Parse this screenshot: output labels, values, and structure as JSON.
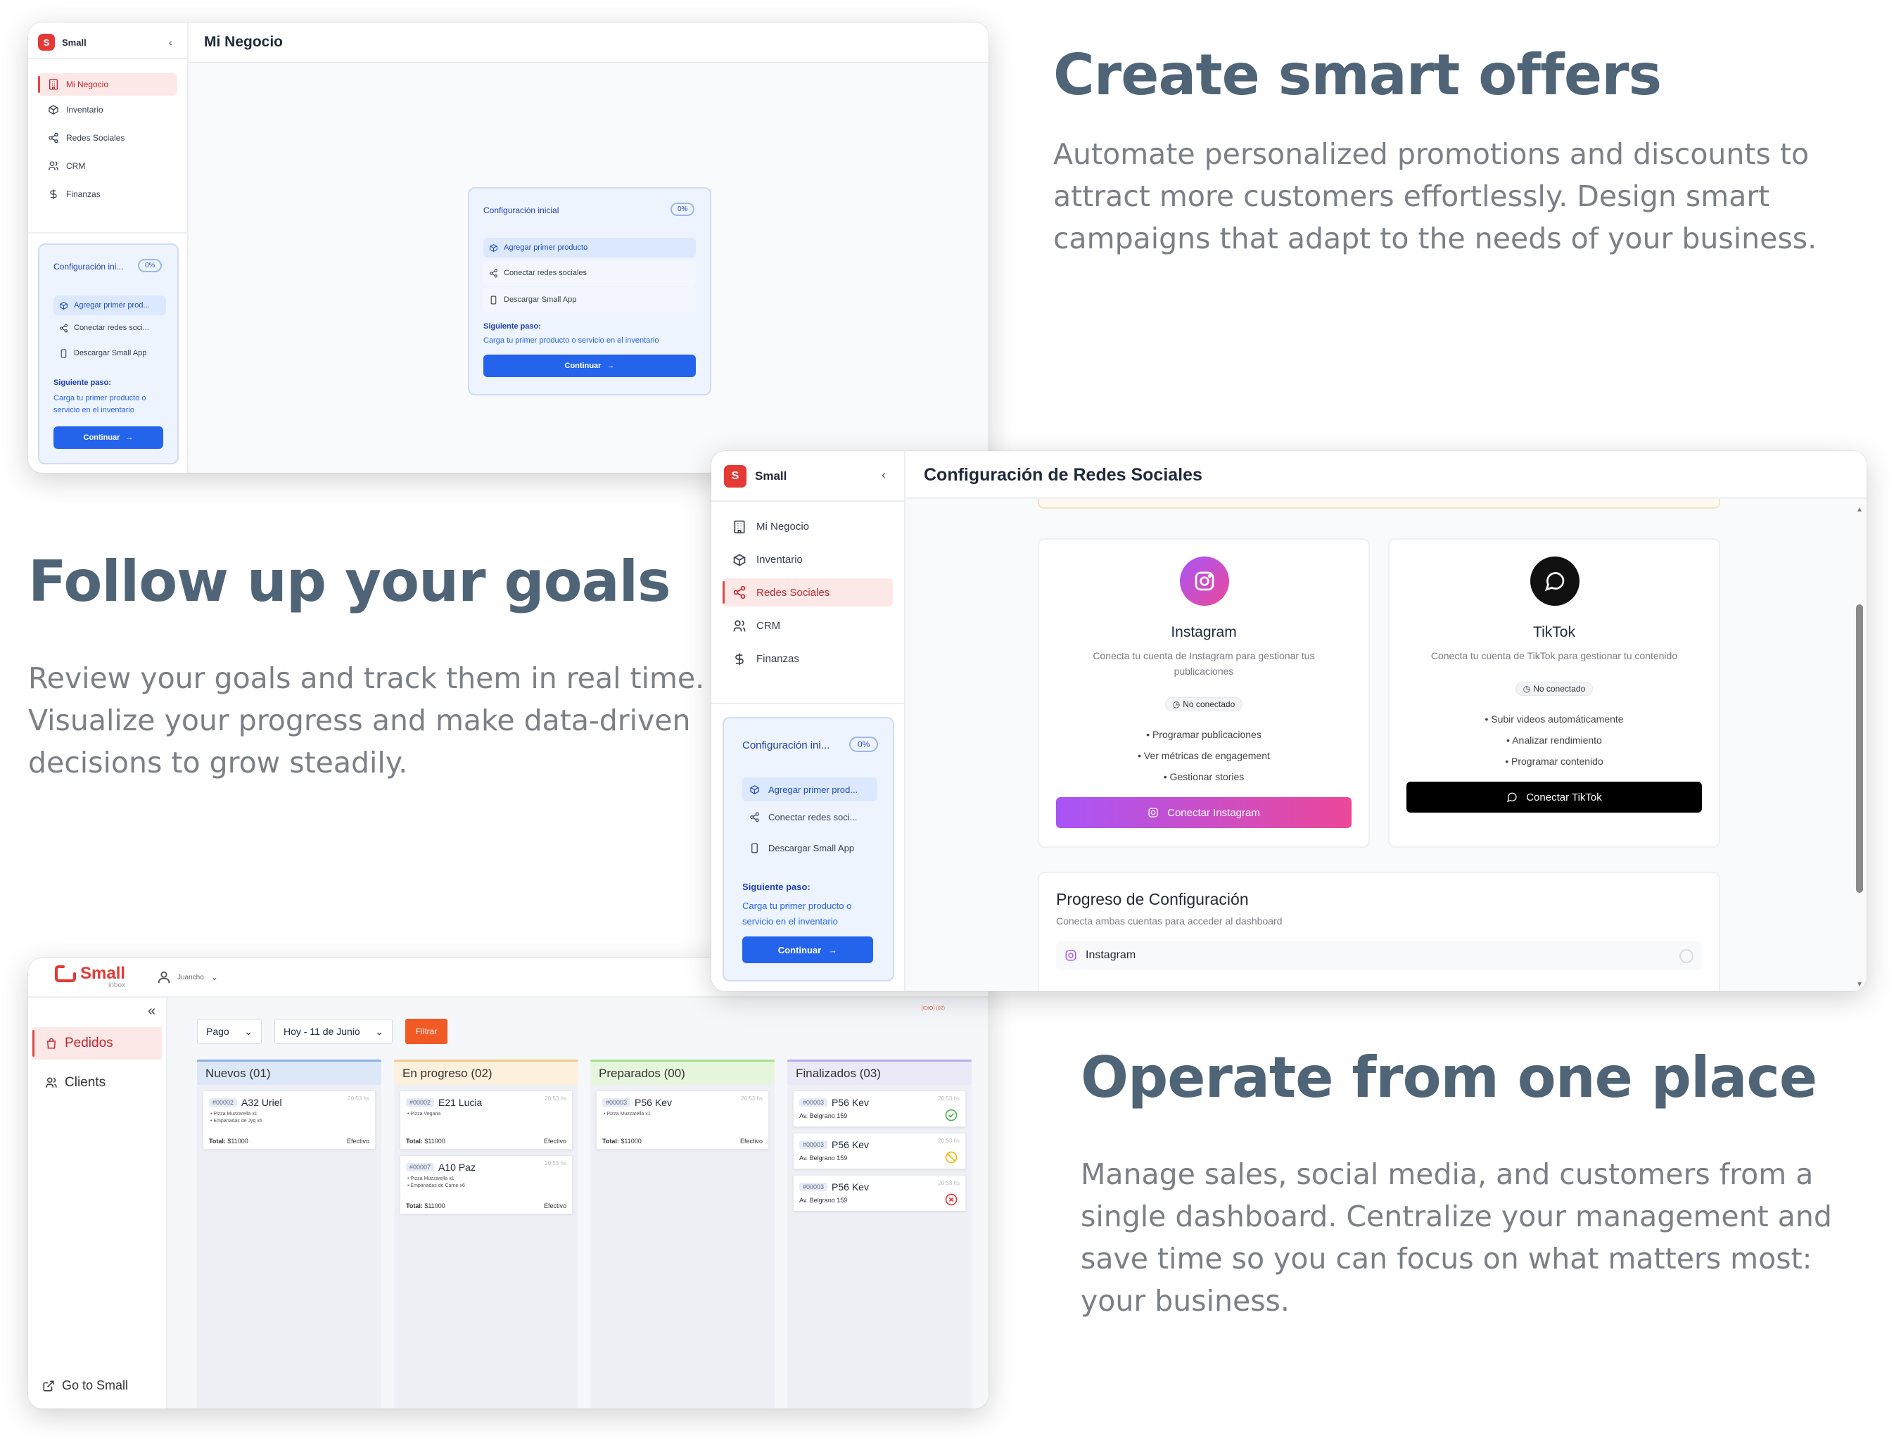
{
  "headings": {
    "smart_offers": {
      "title": "Create smart offers",
      "body": "Automate personalized promotions and discounts to attract more customers effortlessly. Design smart campaigns that adapt to the needs of your business."
    },
    "goals": {
      "title": "Follow up your goals",
      "body": "Review your goals and track them in real time. Visualize your progress and make data-driven decisions to grow steadily."
    },
    "operate": {
      "title": "Operate from one place",
      "body": "Manage sales, social media, and customers from a single dashboard. Centralize your management and save time so you can focus on what matters most: your business."
    }
  },
  "nav": [
    {
      "label": "Mi Negocio",
      "icon": "building-icon"
    },
    {
      "label": "Inventario",
      "icon": "box-icon"
    },
    {
      "label": "Redes Sociales",
      "icon": "share-icon"
    },
    {
      "label": "CRM",
      "icon": "users-icon"
    },
    {
      "label": "Finanzas",
      "icon": "dollar-icon"
    }
  ],
  "app": {
    "logo_letter": "S",
    "name": "Small"
  },
  "setup": {
    "title": "Configuración inicial",
    "title_short": "Configuración ini...",
    "percent": "0%",
    "steps": [
      "Agregar primer producto",
      "Conectar redes sociales",
      "Descargar Small App"
    ],
    "steps_short": [
      "Agregar primer prod...",
      "Conectar redes soci...",
      "Descargar Small App"
    ],
    "next_label": "Siguiente paso:",
    "next_text": "Carga tu primer producto o servicio en el inventario",
    "continue": "Continuar"
  },
  "window1": {
    "page_title": "Mi Negocio"
  },
  "window2": {
    "page_title": "Configuración de Redes Sociales",
    "instagram": {
      "name": "Instagram",
      "desc": "Conecta tu cuenta de Instagram para gestionar tus publicaciones",
      "status": "No conectado",
      "features": [
        "Programar publicaciones",
        "Ver métricas de engagement",
        "Gestionar stories"
      ],
      "button": "Conectar Instagram"
    },
    "tiktok": {
      "name": "TikTok",
      "desc": "Conecta tu cuenta de TikTok para gestionar tu contenido",
      "status": "No conectado",
      "features": [
        "Subir videos automáticamente",
        "Analizar rendimiento",
        "Programar contenido"
      ],
      "button": "Conectar TikTok"
    },
    "progress": {
      "title": "Progreso de Configuración",
      "subtitle": "Conecta ambas cuentas para acceder al dashboard",
      "item": "Instagram"
    }
  },
  "window3": {
    "brand": "Small",
    "brand_sub": "inbox",
    "user": "Juancho",
    "nav": [
      {
        "label": "Pedidos",
        "icon": "bag-icon"
      },
      {
        "label": "Clients",
        "icon": "clients-icon"
      }
    ],
    "footer_link": "Go to Small",
    "filters": {
      "payment": "Pago",
      "date": "Hoy - 11 de Junio",
      "button": "Filtrar",
      "corner_text": "{IDIO} (02)"
    },
    "columns": [
      {
        "title": "Nuevos (01)",
        "color": "#dce8f7",
        "border": "#8fb3e0",
        "cards": [
          {
            "id": "#00002",
            "name": "A32 Uriel",
            "time": "20:53 hs",
            "items": [
              "Pizza Muzzarella x1",
              "Empanadas de Jyq x6"
            ],
            "total": "$11000",
            "pay": "Efectivo"
          }
        ]
      },
      {
        "title": "En progreso (02)",
        "color": "#fdf0dc",
        "border": "#f0c98c",
        "cards": [
          {
            "id": "#00002",
            "name": "E21 Lucia",
            "time": "20:53 hs",
            "items": [
              "Pizza Vegana"
            ],
            "total": "$11000",
            "pay": "Efectivo"
          },
          {
            "id": "#00007",
            "name": "A10 Paz",
            "time": "20:53 hs",
            "items": [
              "Pizza Muzzarella x1",
              "Empanadas de Carne x6"
            ],
            "total": "$11000",
            "pay": "Efectivo"
          }
        ]
      },
      {
        "title": "Preparados (00)",
        "color": "#e6f6dc",
        "border": "#a9dd8c",
        "cards": [
          {
            "id": "#00003",
            "name": "P56 Kev",
            "time": "20:53 hs",
            "items": [
              "Pizza Muzzarella x1"
            ],
            "total": "$11000",
            "pay": "Efectivo"
          }
        ]
      },
      {
        "title": "Finalizados (03)",
        "color": "#ebe8f8",
        "border": "#b8ace6",
        "cards": [
          {
            "id": "#00003",
            "name": "P56 Kev",
            "time": "20:53 hs",
            "address": "Av. Belgrano 159",
            "status_icon": "check-circle-icon",
            "status_color": "#4caf50"
          },
          {
            "id": "#00003",
            "name": "P56 Kev",
            "time": "20:53 hs",
            "address": "Av. Belgrano 159",
            "status_icon": "ban-icon",
            "status_color": "#f2b90c"
          },
          {
            "id": "#00003",
            "name": "P56 Kev",
            "time": "20:53 hs",
            "address": "Av. Belgrano 159",
            "status_icon": "x-circle-icon",
            "status_color": "#e53935"
          }
        ]
      }
    ],
    "total_label": "Total:"
  }
}
